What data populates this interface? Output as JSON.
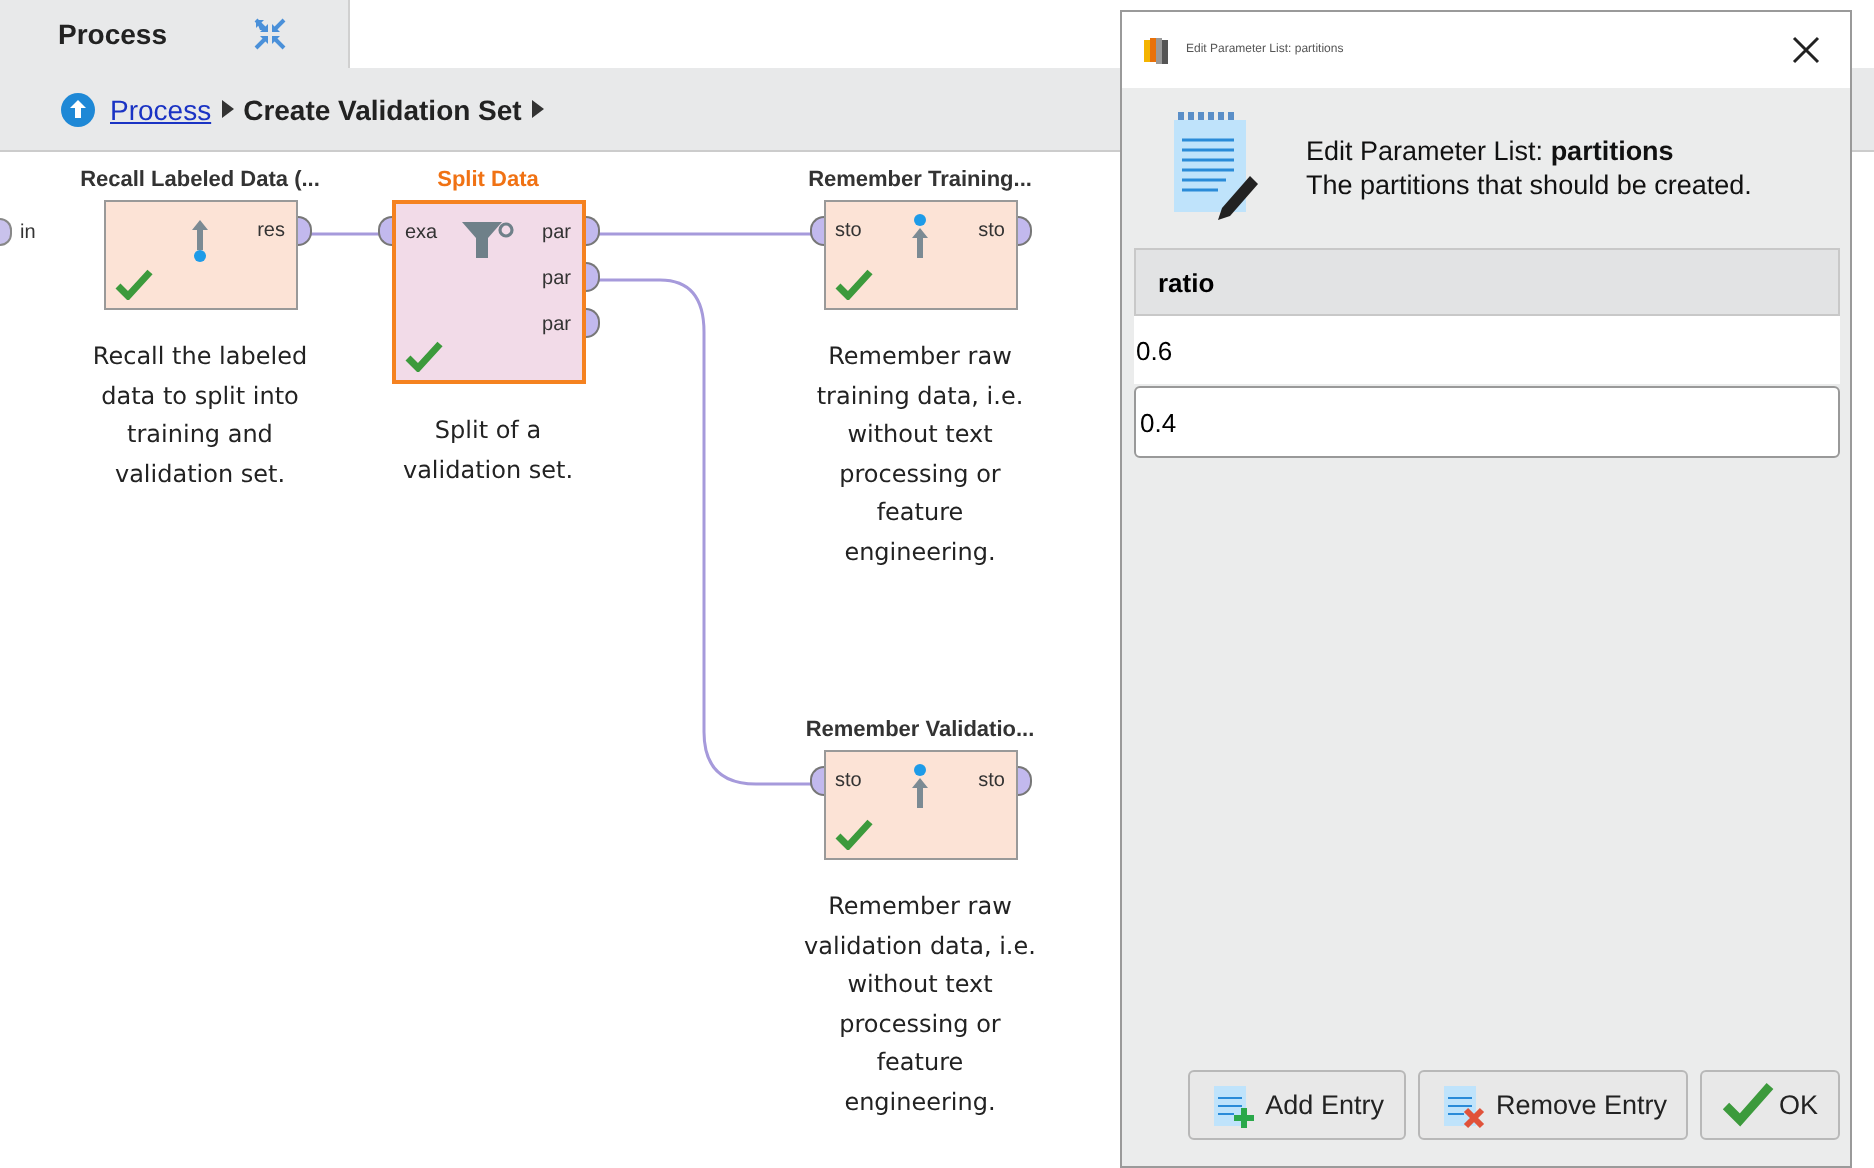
{
  "tab": {
    "label": "Process"
  },
  "breadcrumb": [
    {
      "label": "Process",
      "kind": "link"
    },
    {
      "label": "Create Validation Set",
      "kind": "current"
    }
  ],
  "process_input": {
    "label": "in"
  },
  "operators": [
    {
      "title": "Recall Labeled Data (...",
      "selected": false,
      "kind": "recall",
      "outputs": [
        "res"
      ],
      "description_lines": [
        "Recall the labeled",
        "data to split into",
        "training and",
        "validation set."
      ]
    },
    {
      "title": "Split Data",
      "selected": true,
      "kind": "split",
      "inputs": [
        "exa"
      ],
      "outputs": [
        "par",
        "par",
        "par"
      ],
      "description_lines": [
        "Split of a",
        "validation set."
      ]
    },
    {
      "title": "Remember Training...",
      "selected": false,
      "kind": "remember",
      "inputs": [
        "sto"
      ],
      "outputs": [
        "sto"
      ],
      "description_lines": [
        "Remember raw",
        "training data, i.e.",
        "without text",
        "processing or",
        "feature",
        "engineering."
      ]
    },
    {
      "title": "Remember Validatio...",
      "selected": false,
      "kind": "remember",
      "inputs": [
        "sto"
      ],
      "outputs": [
        "sto"
      ],
      "description_lines": [
        "Remember raw",
        "validation data, i.e.",
        "without text",
        "processing or",
        "feature",
        "engineering."
      ]
    }
  ],
  "dialog": {
    "title": "Edit Parameter List: partitions",
    "heading": "Edit Parameter List: **partitions**",
    "subtitle": "The partitions that should be created.",
    "column": "ratio",
    "rows": [
      {
        "value": "0.6",
        "selected": false
      },
      {
        "value": "0.4",
        "selected": true
      }
    ],
    "buttons": [
      {
        "label": "Add Entry",
        "kind": "add"
      },
      {
        "label": "Remove Entry",
        "kind": "remove"
      },
      {
        "label": "OK",
        "kind": "ok"
      }
    ]
  }
}
